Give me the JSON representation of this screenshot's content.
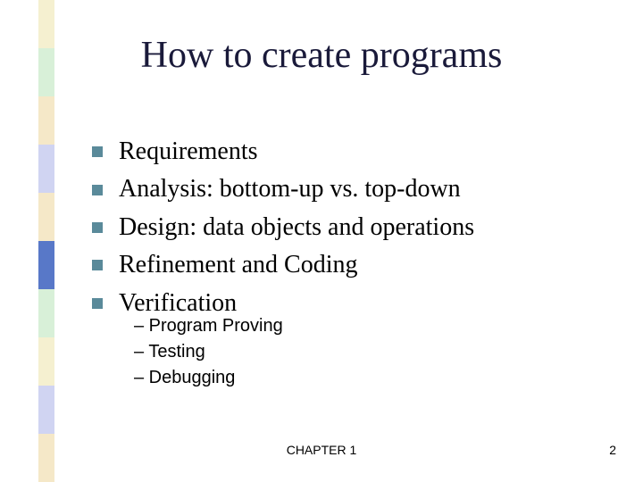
{
  "sidebar": {
    "colors": [
      "#f5f0d0",
      "#d8f0d8",
      "#f5e8c8",
      "#d0d4f2",
      "#f5e8c8",
      "#5878c8",
      "#d8f0d8",
      "#f5f0d0",
      "#d0d4f2",
      "#f5e8c8"
    ]
  },
  "title": "How to create programs",
  "bullets": [
    "Requirements",
    "Analysis: bottom-up vs. top-down",
    "Design: data objects and operations",
    "Refinement and Coding",
    "Verification"
  ],
  "sub_bullets": [
    "– Program Proving",
    "– Testing",
    "– Debugging"
  ],
  "footer": {
    "center": "CHAPTER 1",
    "page": "2"
  }
}
